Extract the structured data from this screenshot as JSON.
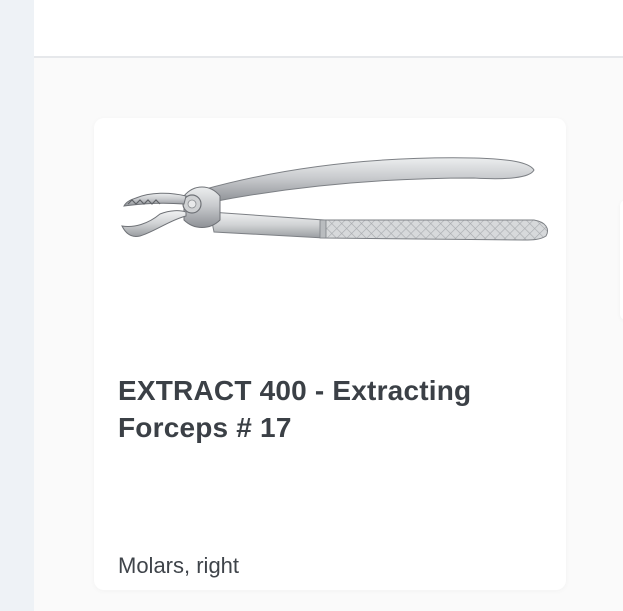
{
  "product_card": {
    "image_name": "extracting-forceps",
    "title": "EXTRACT 400 - Extracting Forceps # 17",
    "subtitle": "Molars, right"
  },
  "colors": {
    "page_background": "#fafafa",
    "rail_background": "#eef2f6",
    "card_background": "#ffffff",
    "title_text": "#3b4046",
    "metal_light": "#d4d6d8",
    "metal_dark": "#8e9196"
  }
}
